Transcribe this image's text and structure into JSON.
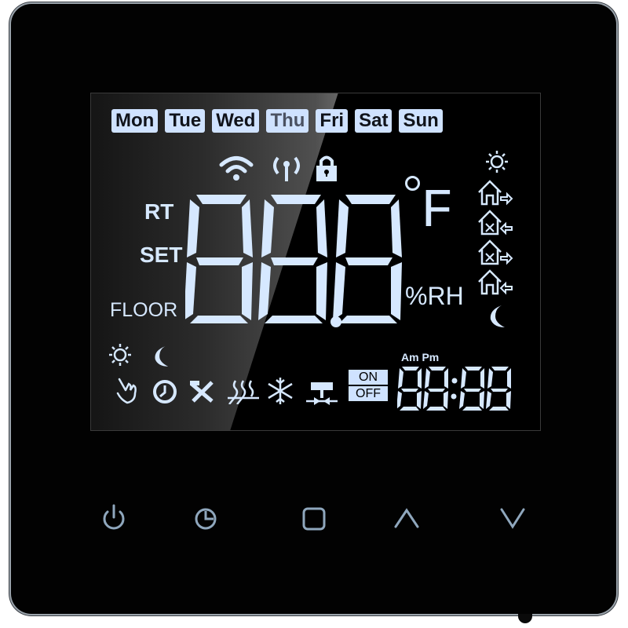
{
  "device": {
    "type": "thermostat",
    "accent_color": "#cfe2ff",
    "lcd_segment_color": "#d6e8ff",
    "bezel_color": "#020202"
  },
  "days": [
    {
      "label": "Mon",
      "active": true
    },
    {
      "label": "Tue",
      "active": true
    },
    {
      "label": "Wed",
      "active": true
    },
    {
      "label": "Thu",
      "active": false
    },
    {
      "label": "Fri",
      "active": true
    },
    {
      "label": "Sat",
      "active": true
    },
    {
      "label": "Sun",
      "active": true
    }
  ],
  "status_icons": [
    "wifi-icon",
    "signal-antenna-icon",
    "lock-icon"
  ],
  "mode_labels": {
    "rt": "RT",
    "set": "SET",
    "floor": "FLOOR"
  },
  "main_display": {
    "value": "88.8",
    "unit": "F",
    "humidity_unit": "%RH"
  },
  "schedule_icons": [
    "sun-icon",
    "house-leave-icon",
    "house-meal-return-icon",
    "house-meal-leave-icon",
    "house-return-icon",
    "moon-icon"
  ],
  "bottom_icons": {
    "row1": [
      "sun-icon",
      "moon-icon"
    ],
    "row2": [
      "manual-hand-icon",
      "clock-icon",
      "tools-icon",
      "floor-heating-icon",
      "snowflake-icon",
      "valve-icon"
    ]
  },
  "onoff": {
    "on": "ON",
    "off": "OFF"
  },
  "clock": {
    "am": "Am",
    "pm": "Pm",
    "time": "88:88"
  },
  "buttons": [
    {
      "name": "power-button",
      "icon": "power-icon"
    },
    {
      "name": "schedule-button",
      "icon": "clock-pie-icon"
    },
    {
      "name": "mode-button",
      "icon": "square-icon"
    },
    {
      "name": "up-button",
      "icon": "chevron-up-icon"
    },
    {
      "name": "down-button",
      "icon": "chevron-down-icon"
    }
  ]
}
